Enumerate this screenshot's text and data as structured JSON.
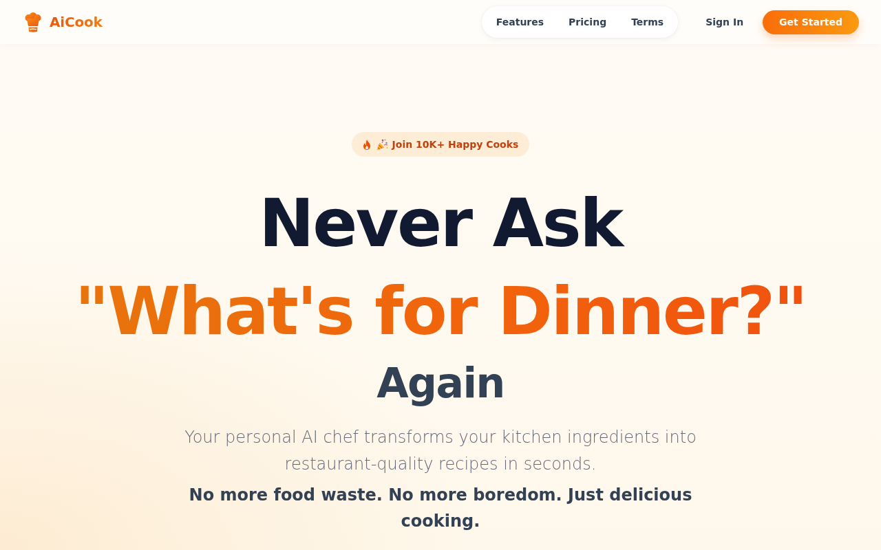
{
  "header": {
    "logo": {
      "text": "AiCook"
    },
    "nav": [
      {
        "label": "Features"
      },
      {
        "label": "Pricing"
      },
      {
        "label": "Terms"
      }
    ],
    "sign_in": "Sign In",
    "cta": "Get Started"
  },
  "hero": {
    "badge": "Join 10K+ Happy Cooks",
    "headline": {
      "line_1": "Never Ask",
      "line_2": "\"What's for Dinner?\"",
      "line_3": "Again"
    },
    "subtitle": "Your personal AI chef transforms your kitchen ingredients into restaurant-quality recipes in seconds.",
    "tagline": "No more food waste. No more boredom. Just delicious cooking."
  }
}
